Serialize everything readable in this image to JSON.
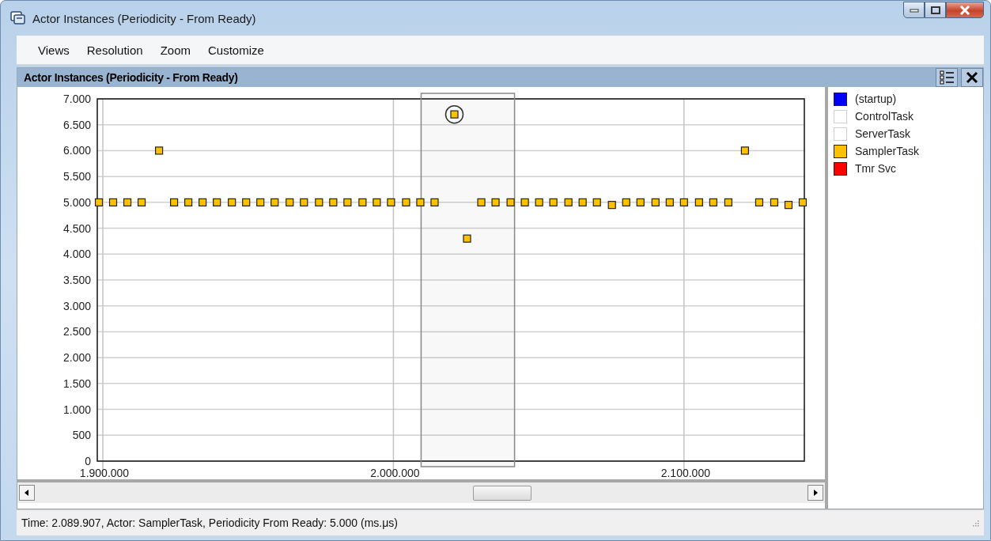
{
  "window": {
    "title": "Actor Instances (Periodicity - From Ready)"
  },
  "menu": [
    "Views",
    "Resolution",
    "Zoom",
    "Customize"
  ],
  "panel": {
    "title": "Actor Instances (Periodicity - From Ready)",
    "chart_data": {
      "type": "scatter",
      "grid": true,
      "x": [
        1898640,
        1903540,
        1908450,
        1913350,
        1919350,
        1924520,
        1929430,
        1934330,
        1939240,
        1944410,
        1949320,
        1954220,
        1959130,
        1964310,
        1969210,
        1974390,
        1979290,
        1984200,
        1989370,
        1994280,
        1999180,
        2004360,
        2009260,
        2014170,
        2020980,
        2025340,
        2030250,
        2035150,
        2040330,
        2045230,
        2050140,
        2055040,
        2060220,
        2065120,
        2070030,
        2075200,
        2080110,
        2085010,
        2090190,
        2095100,
        2100000,
        2105180,
        2110080,
        2115260,
        2120980,
        2125890,
        2131060,
        2135970,
        2140870
      ],
      "series": [
        {
          "name": "(startup)",
          "color": "#0000ff",
          "values": [
            null,
            null,
            null,
            null,
            null,
            null,
            null,
            null,
            null,
            null,
            null,
            null,
            null,
            null,
            null,
            null,
            null,
            null,
            null,
            null,
            null,
            null,
            null,
            null,
            null,
            null,
            null,
            null,
            null,
            null,
            null,
            null,
            null,
            null,
            null,
            null,
            null,
            null,
            null,
            null,
            null,
            null,
            null,
            null,
            null,
            null,
            null,
            null,
            null
          ]
        },
        {
          "name": "ControlTask",
          "color": "#ffffff",
          "values": [
            null,
            null,
            null,
            null,
            null,
            null,
            null,
            null,
            null,
            null,
            null,
            null,
            null,
            null,
            null,
            null,
            null,
            null,
            null,
            null,
            null,
            null,
            null,
            null,
            null,
            null,
            null,
            null,
            null,
            null,
            null,
            null,
            null,
            null,
            null,
            null,
            null,
            null,
            null,
            null,
            null,
            null,
            null,
            null,
            null,
            null,
            null,
            null,
            null
          ]
        },
        {
          "name": "ServerTask",
          "color": "#ffffff",
          "values": [
            null,
            null,
            null,
            null,
            null,
            null,
            null,
            null,
            null,
            null,
            null,
            null,
            null,
            null,
            null,
            null,
            null,
            null,
            null,
            null,
            null,
            null,
            null,
            null,
            null,
            null,
            null,
            null,
            null,
            null,
            null,
            null,
            null,
            null,
            null,
            null,
            null,
            null,
            null,
            null,
            null,
            null,
            null,
            null,
            null,
            null,
            null,
            null,
            null
          ]
        },
        {
          "name": "SamplerTask",
          "color": "#ffc000",
          "values": [
            5000,
            5000,
            5000,
            5000,
            6000,
            5000,
            5000,
            5000,
            5000,
            5000,
            5000,
            5000,
            5000,
            5000,
            5000,
            5000,
            5000,
            5000,
            5000,
            5000,
            5000,
            5000,
            5000,
            5000,
            6700,
            4300,
            5000,
            5000,
            5000,
            5000,
            5000,
            5000,
            5000,
            5000,
            5000,
            4950,
            5000,
            5000,
            5000,
            5000,
            5000,
            5000,
            5000,
            5000,
            6000,
            5000,
            5000,
            4950,
            5000
          ]
        },
        {
          "name": "Tmr Svc",
          "color": "#ff0000",
          "values": [
            null,
            null,
            null,
            null,
            null,
            null,
            null,
            null,
            null,
            null,
            null,
            null,
            null,
            null,
            null,
            null,
            null,
            null,
            null,
            null,
            null,
            null,
            null,
            null,
            null,
            null,
            null,
            null,
            null,
            null,
            null,
            null,
            null,
            null,
            null,
            null,
            null,
            null,
            null,
            null,
            null,
            null,
            null,
            null,
            null,
            null,
            null,
            null,
            null
          ]
        }
      ],
      "xlim": [
        1898090,
        2141420
      ],
      "ylim": [
        0,
        7000
      ],
      "xticks": [
        {
          "value": 1900000,
          "label": "1.900.000"
        },
        {
          "value": 2000000,
          "label": "2.000.000"
        },
        {
          "value": 2100000,
          "label": "2.100.000"
        }
      ],
      "yticks": [
        {
          "value": 0,
          "label": "0"
        },
        {
          "value": 500,
          "label": "500"
        },
        {
          "value": 1000,
          "label": "1.000"
        },
        {
          "value": 1500,
          "label": "1.500"
        },
        {
          "value": 2000,
          "label": "2.000"
        },
        {
          "value": 2500,
          "label": "2.500"
        },
        {
          "value": 3000,
          "label": "3.000"
        },
        {
          "value": 3500,
          "label": "3.500"
        },
        {
          "value": 4000,
          "label": "4.000"
        },
        {
          "value": 4500,
          "label": "4.500"
        },
        {
          "value": 5000,
          "label": "5.000"
        },
        {
          "value": 5500,
          "label": "5.500"
        },
        {
          "value": 6000,
          "label": "6.000"
        },
        {
          "value": 6500,
          "label": "6.500"
        },
        {
          "value": 7000,
          "label": "7.000"
        }
      ],
      "bands": [
        {
          "axis": "x",
          "from": 2009530,
          "to": 2041690
        }
      ]
    }
  },
  "status_bar": "Time: 2.089.907, Actor: SamplerTask, Periodicity From Ready: 5.000 (ms.μs)"
}
